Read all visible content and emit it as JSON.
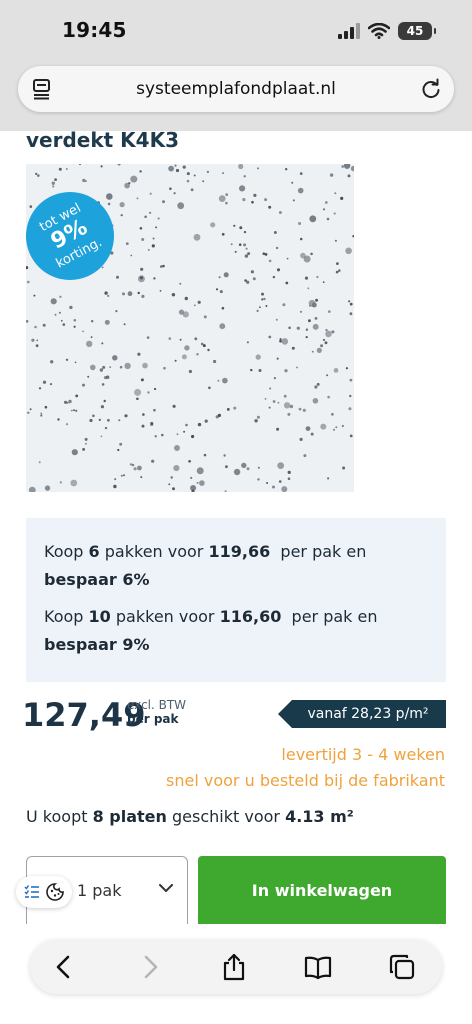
{
  "status_bar": {
    "time": "19:45",
    "battery": "45"
  },
  "browser": {
    "url": "systeemplafondplaat.nl"
  },
  "product": {
    "title": "verdekt K4K3",
    "badge": {
      "line1": "tot wel",
      "line2": "9%",
      "line3": "korting."
    }
  },
  "bulk_offers": [
    {
      "prefix": "Koop",
      "qty": "6",
      "mid": "pakken voor",
      "price": "119,66",
      "suffix": "per pak en",
      "save": "bespaar 6%"
    },
    {
      "prefix": "Koop",
      "qty": "10",
      "mid": "pakken voor",
      "price": "116,60",
      "suffix": "per pak en",
      "save": "bespaar 9%"
    }
  ],
  "pricing": {
    "price": "127,49",
    "vat_label": "excl. BTW",
    "unit_label": "per pak",
    "from_per_m2": "vanaf 28,23 p/m²"
  },
  "delivery": {
    "lead_time": "levertijd 3 - 4 weken",
    "note": "snel voor u besteld bij de fabrikant"
  },
  "purchase_info": {
    "prefix": "U koopt",
    "plates": "8 platen",
    "mid": "geschikt voor",
    "area": "4.13 m²"
  },
  "cart": {
    "quantity": "1 pak",
    "add_button": "In winkelwagen"
  },
  "colors": {
    "accent_green": "#3fa82e",
    "badge_blue": "#1ea2dc",
    "dark_blue": "#183a4b",
    "orange": "#f0a23c"
  }
}
